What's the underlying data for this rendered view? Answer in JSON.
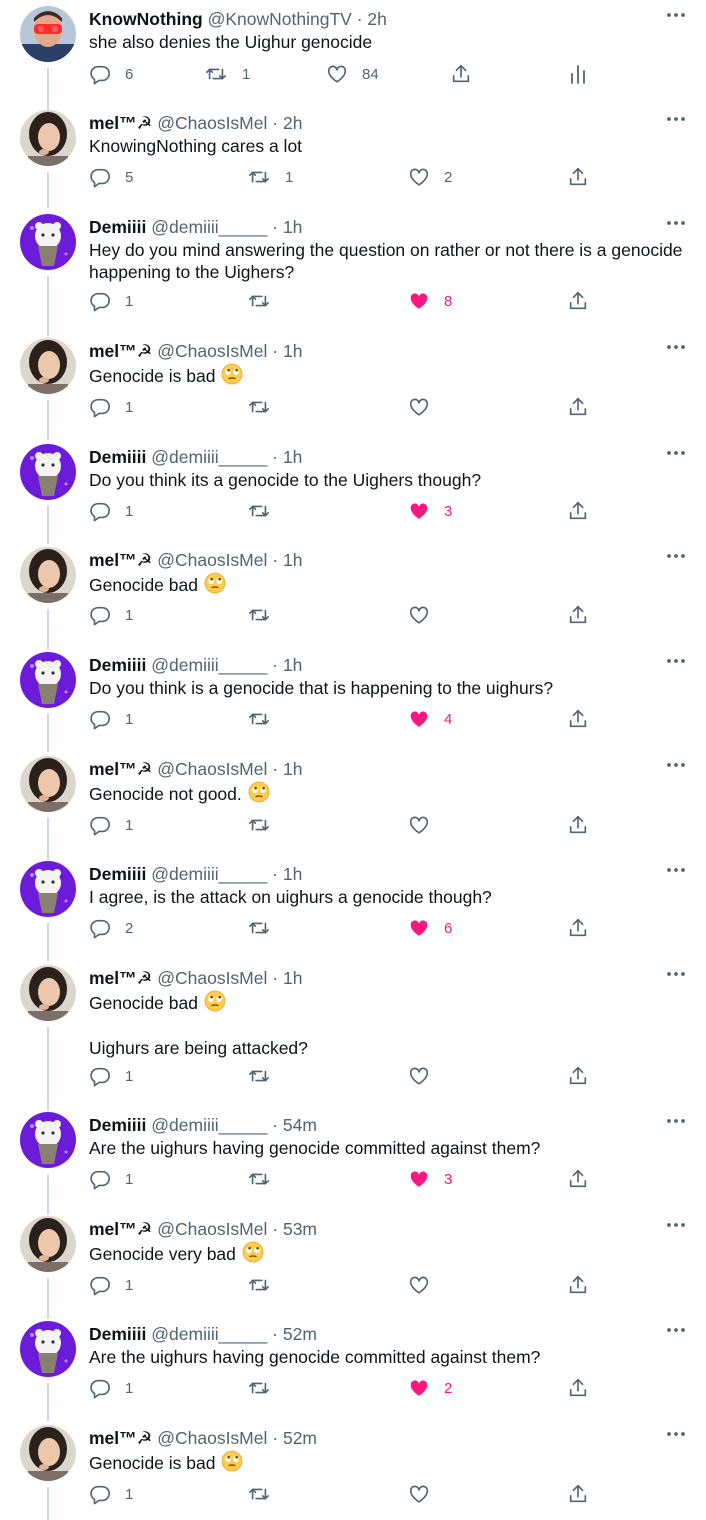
{
  "tweets": [
    {
      "name": "KnowNothing",
      "handle": "@KnowNothingTV",
      "time": "2h",
      "lines": [
        "she also denies the Uighur genocide"
      ],
      "replies": "6",
      "retweets": "1",
      "likes": "84",
      "liked": false,
      "avatar": "knownothing",
      "analytics": true
    },
    {
      "name": "mel™☭",
      "handle": "@ChaosIsMel",
      "time": "2h",
      "lines": [
        "KnowingNothing cares a lot"
      ],
      "replies": "5",
      "retweets": "1",
      "likes": "2",
      "liked": false,
      "avatar": "mel"
    },
    {
      "name": "Demiiii",
      "handle": "@demiiii_____",
      "time": "1h",
      "lines": [
        "Hey do you mind answering the question on rather or not there is a genocide happening to the Uighers?"
      ],
      "replies": "1",
      "retweets": "",
      "likes": "8",
      "liked": true,
      "avatar": "demi"
    },
    {
      "name": "mel™☭",
      "handle": "@ChaosIsMel",
      "time": "1h",
      "lines": [
        "Genocide is bad"
      ],
      "emoji": "rolling-eyes-emoji",
      "replies": "1",
      "retweets": "",
      "likes": "",
      "liked": false,
      "avatar": "mel"
    },
    {
      "name": "Demiiii",
      "handle": "@demiiii_____",
      "time": "1h",
      "lines": [
        "Do you think its a genocide to the Uighers though?"
      ],
      "replies": "1",
      "retweets": "",
      "likes": "3",
      "liked": true,
      "avatar": "demi"
    },
    {
      "name": "mel™☭",
      "handle": "@ChaosIsMel",
      "time": "1h",
      "lines": [
        "Genocide bad"
      ],
      "emoji": "rolling-eyes-emoji",
      "replies": "1",
      "retweets": "",
      "likes": "",
      "liked": false,
      "avatar": "mel"
    },
    {
      "name": "Demiiii",
      "handle": "@demiiii_____",
      "time": "1h",
      "lines": [
        "Do you think is a genocide that is happening to the uighurs?"
      ],
      "replies": "1",
      "retweets": "",
      "likes": "4",
      "liked": true,
      "avatar": "demi"
    },
    {
      "name": "mel™☭",
      "handle": "@ChaosIsMel",
      "time": "1h",
      "lines": [
        "Genocide not good."
      ],
      "emoji": "rolling-eyes-emoji",
      "replies": "1",
      "retweets": "",
      "likes": "",
      "liked": false,
      "avatar": "mel"
    },
    {
      "name": "Demiiii",
      "handle": "@demiiii_____",
      "time": "1h",
      "lines": [
        "I agree, is the attack on uighurs a genocide though?"
      ],
      "replies": "2",
      "retweets": "",
      "likes": "6",
      "liked": true,
      "avatar": "demi"
    },
    {
      "name": "mel™☭",
      "handle": "@ChaosIsMel",
      "time": "1h",
      "lines": [
        "Genocide bad",
        "Uighurs are being attacked?"
      ],
      "emoji": "rolling-eyes-emoji",
      "replies": "1",
      "retweets": "",
      "likes": "",
      "liked": false,
      "avatar": "mel"
    },
    {
      "name": "Demiiii",
      "handle": "@demiiii_____",
      "time": "54m",
      "lines": [
        "Are the uighurs having genocide committed against them?"
      ],
      "replies": "1",
      "retweets": "",
      "likes": "3",
      "liked": true,
      "avatar": "demi"
    },
    {
      "name": "mel™☭",
      "handle": "@ChaosIsMel",
      "time": "53m",
      "lines": [
        "Genocide very bad"
      ],
      "emoji": "rolling-eyes-emoji",
      "replies": "1",
      "retweets": "",
      "likes": "",
      "liked": false,
      "avatar": "mel"
    },
    {
      "name": "Demiiii",
      "handle": "@demiiii_____",
      "time": "52m",
      "lines": [
        "Are the uighurs having genocide committed against them?"
      ],
      "replies": "1",
      "retweets": "",
      "likes": "2",
      "liked": true,
      "avatar": "demi"
    },
    {
      "name": "mel™☭",
      "handle": "@ChaosIsMel",
      "time": "52m",
      "lines": [
        "Genocide is bad"
      ],
      "emoji": "rolling-eyes-emoji",
      "replies": "1",
      "retweets": "",
      "likes": "",
      "liked": false,
      "avatar": "mel"
    }
  ],
  "colors": {
    "text": "#0f1419",
    "muted": "#536471",
    "like": "#f91880",
    "connector": "#cfd9de"
  },
  "icons": {
    "reply": "reply-icon",
    "retweet": "retweet-icon",
    "like": "heart-icon",
    "share": "share-icon",
    "analytics": "analytics-icon",
    "more": "more-icon"
  }
}
